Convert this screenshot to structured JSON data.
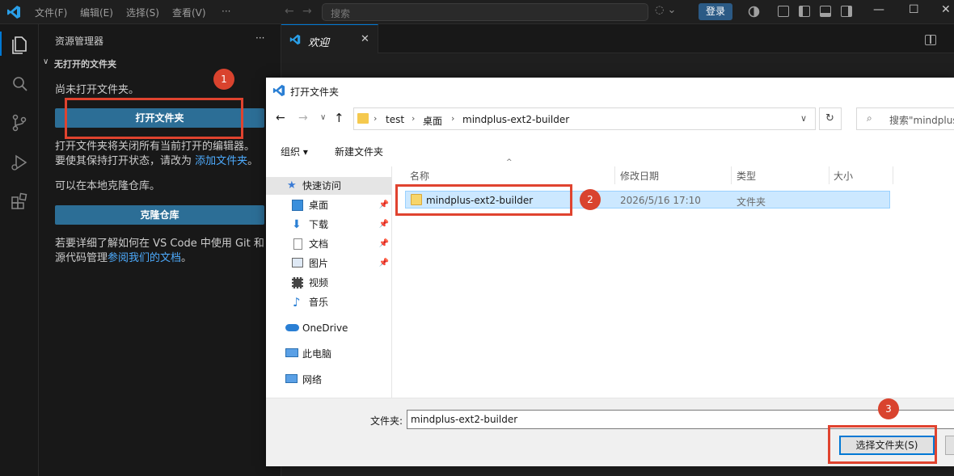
{
  "titlebar": {
    "menu": [
      "文件(F)",
      "编辑(E)",
      "选择(S)",
      "查看(V)",
      "···"
    ],
    "search_placeholder": "搜索",
    "login_label": "登录",
    "window_controls": [
      "minimize-icon",
      "maximize-icon",
      "close-icon"
    ]
  },
  "activitybar": {
    "icons": [
      "files-icon",
      "search-icon",
      "source-control-icon",
      "run-debug-icon",
      "extensions-icon"
    ]
  },
  "sidebar": {
    "title": "资源管理器",
    "more": "···",
    "section_title": "无打开的文件夹",
    "no_folder_text": "尚未打开文件夹。",
    "open_folder_label": "打开文件夹",
    "close_editors_text_1": "打开文件夹将关闭所有当前打开的编辑器。",
    "close_editors_text_2": "要使其保持打开状态，请改为 ",
    "add_folder_link": "添加文件夹",
    "period": "。",
    "clone_text": "可以在本地克隆仓库。",
    "clone_label": "克隆仓库",
    "git_text_1": "若要详细了解如何在 VS Code 中使用 Git 和",
    "git_text_2": "源代码管理",
    "git_link": "参阅我们的文档",
    "period2": "。"
  },
  "editor": {
    "tab_label": "欢迎"
  },
  "annotations": {
    "badge1": "1",
    "badge2": "2",
    "badge3": "3",
    "color": "#e0432f"
  },
  "dialog": {
    "title": "打开文件夹",
    "breadcrumb": [
      "test",
      "桌面",
      "mindplus-ext2-builder"
    ],
    "search_placeholder": "搜索\"mindplus",
    "organize_label": "组织",
    "new_folder_label": "新建文件夹",
    "nav_items": [
      {
        "label": "快速访问",
        "icon": "star-icon"
      },
      {
        "label": "桌面",
        "icon": "desktop-icon",
        "pinned": true
      },
      {
        "label": "下载",
        "icon": "download-icon",
        "pinned": true
      },
      {
        "label": "文档",
        "icon": "document-icon",
        "pinned": true
      },
      {
        "label": "图片",
        "icon": "picture-icon",
        "pinned": true
      },
      {
        "label": "视频",
        "icon": "video-icon"
      },
      {
        "label": "音乐",
        "icon": "music-icon"
      },
      {
        "label": "OneDrive",
        "icon": "cloud-icon"
      },
      {
        "label": "此电脑",
        "icon": "computer-icon"
      },
      {
        "label": "网络",
        "icon": "network-icon"
      }
    ],
    "columns": [
      "名称",
      "修改日期",
      "类型",
      "大小"
    ],
    "rows": [
      {
        "name": "mindplus-ext2-builder",
        "date": "2026/5/16 17:10",
        "type": "文件夹",
        "size": ""
      }
    ],
    "folder_label": "文件夹:",
    "folder_value": "mindplus-ext2-builder",
    "select_button": "选择文件夹(S)"
  }
}
